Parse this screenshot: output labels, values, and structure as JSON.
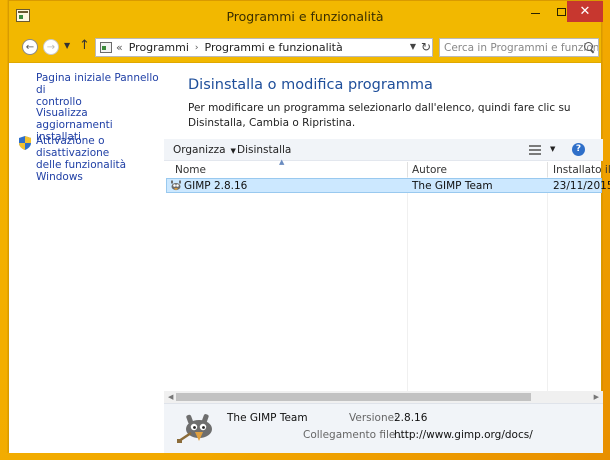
{
  "window": {
    "title": "Programmi e funzionalità"
  },
  "address_bar": {
    "breadcrumb_prefix": "«",
    "breadcrumbs": [
      "Programmi",
      "Programmi e funzionalità"
    ],
    "search_placeholder": "Cerca in Programmi e funzion..."
  },
  "sidebar": {
    "links": [
      {
        "label_line1": "Pagina iniziale Pannello di",
        "label_line2": "controllo"
      },
      {
        "label_line1": "Visualizza aggiornamenti",
        "label_line2": "installati"
      },
      {
        "label_line1": "Attivazione o disattivazione",
        "label_line2": "delle funzionalità Windows",
        "icon": "shield-icon"
      }
    ]
  },
  "main": {
    "heading": "Disinstalla o modifica programma",
    "description": "Per modificare un programma selezionarlo dall'elenco, quindi fare clic su Disinstalla, Cambia o Ripristina.",
    "toolbar": {
      "organize_label": "Organizza",
      "uninstall_label": "Disinstalla"
    },
    "columns": [
      "Nome",
      "Autore",
      "Installato il"
    ],
    "rows": [
      {
        "name": "GIMP 2.8.16",
        "publisher": "The GIMP Team",
        "installed": "23/11/2015",
        "icon": "gimp-icon"
      }
    ]
  },
  "details": {
    "name": "The GIMP Team",
    "version_label": "Versione:",
    "version_value": "2.8.16",
    "link_label": "Collegamento file ...",
    "link_value": "http://www.gimp.org/docs/"
  },
  "colors": {
    "accent_title_bar": "#f2b800",
    "heading_blue": "#1e4e9a",
    "link_blue": "#1f3fa5",
    "selection": "#cce8ff",
    "close_button": "#c7372f"
  }
}
